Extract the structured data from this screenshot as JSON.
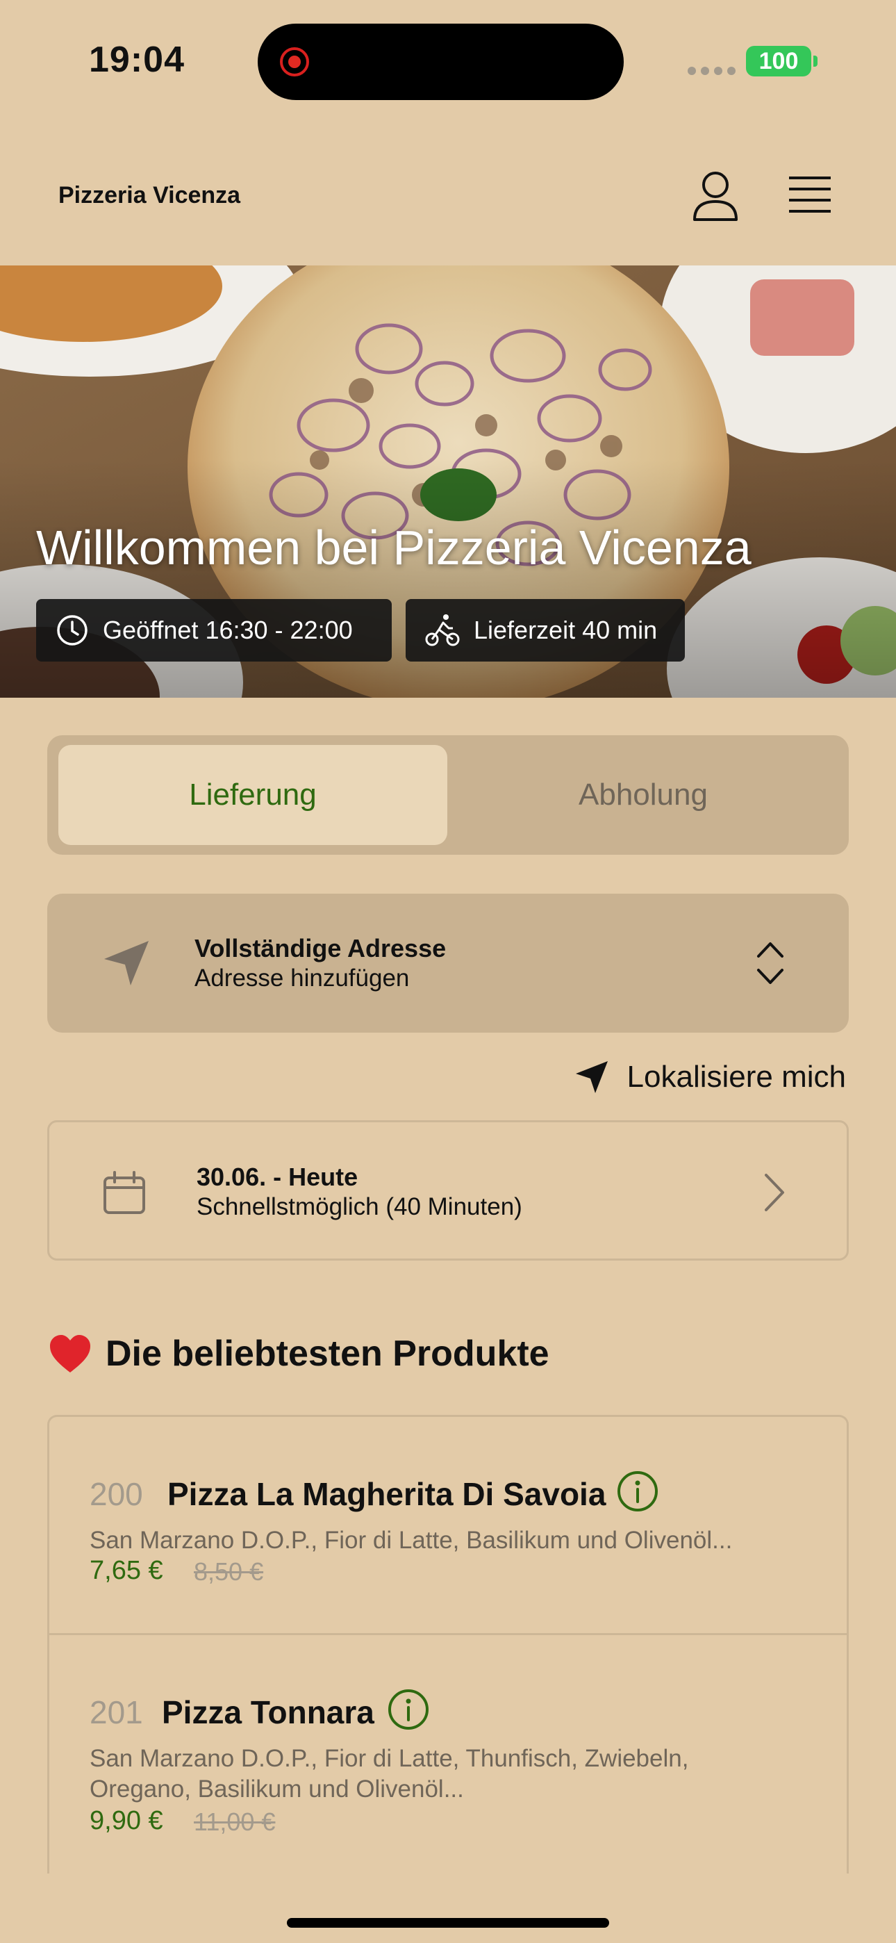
{
  "status_bar": {
    "time": "19:04",
    "battery": "100"
  },
  "header": {
    "brand": "Pizzeria Vicenza"
  },
  "hero": {
    "title": "Willkommen bei Pizzeria Vicenza",
    "opening_hours": "Geöffnet 16:30 - 22:00",
    "delivery_time": "Lieferzeit 40 min"
  },
  "tabs": {
    "delivery": "Lieferung",
    "pickup": "Abholung",
    "active": "delivery"
  },
  "address": {
    "title": "Vollständige Adresse",
    "subtitle": "Adresse hinzufügen"
  },
  "locate": {
    "label": "Lokalisiere mich"
  },
  "date": {
    "title": "30.06. - Heute",
    "subtitle": "Schnellstmöglich (40 Minuten)"
  },
  "popular": {
    "title": "Die beliebtesten Produkte",
    "products": [
      {
        "number": "200",
        "name": "Pizza La Magherita Di Savoia",
        "description": "San Marzano D.O.P., Fior di Latte, Basilikum und Olivenöl...",
        "price": "7,65 €",
        "old_price": "8,50 €"
      },
      {
        "number": "201",
        "name": "Pizza Tonnara",
        "description": "San Marzano D.O.P., Fior di Latte, Thunfisch, Zwiebeln, Oregano, Basilikum und Olivenöl...",
        "price": "9,90 €",
        "old_price": "11,00 €"
      }
    ]
  },
  "colors": {
    "background": "#e3cba8",
    "accent_green": "#2f6a10",
    "card": "#c9b291",
    "muted_text": "#6f6558"
  },
  "icons": [
    "user-icon",
    "menu-icon",
    "clock-icon",
    "bike-icon",
    "navigation-arrow-icon",
    "updown-chevron-icon",
    "calendar-icon",
    "chevron-right-icon",
    "heart-icon",
    "info-icon"
  ]
}
